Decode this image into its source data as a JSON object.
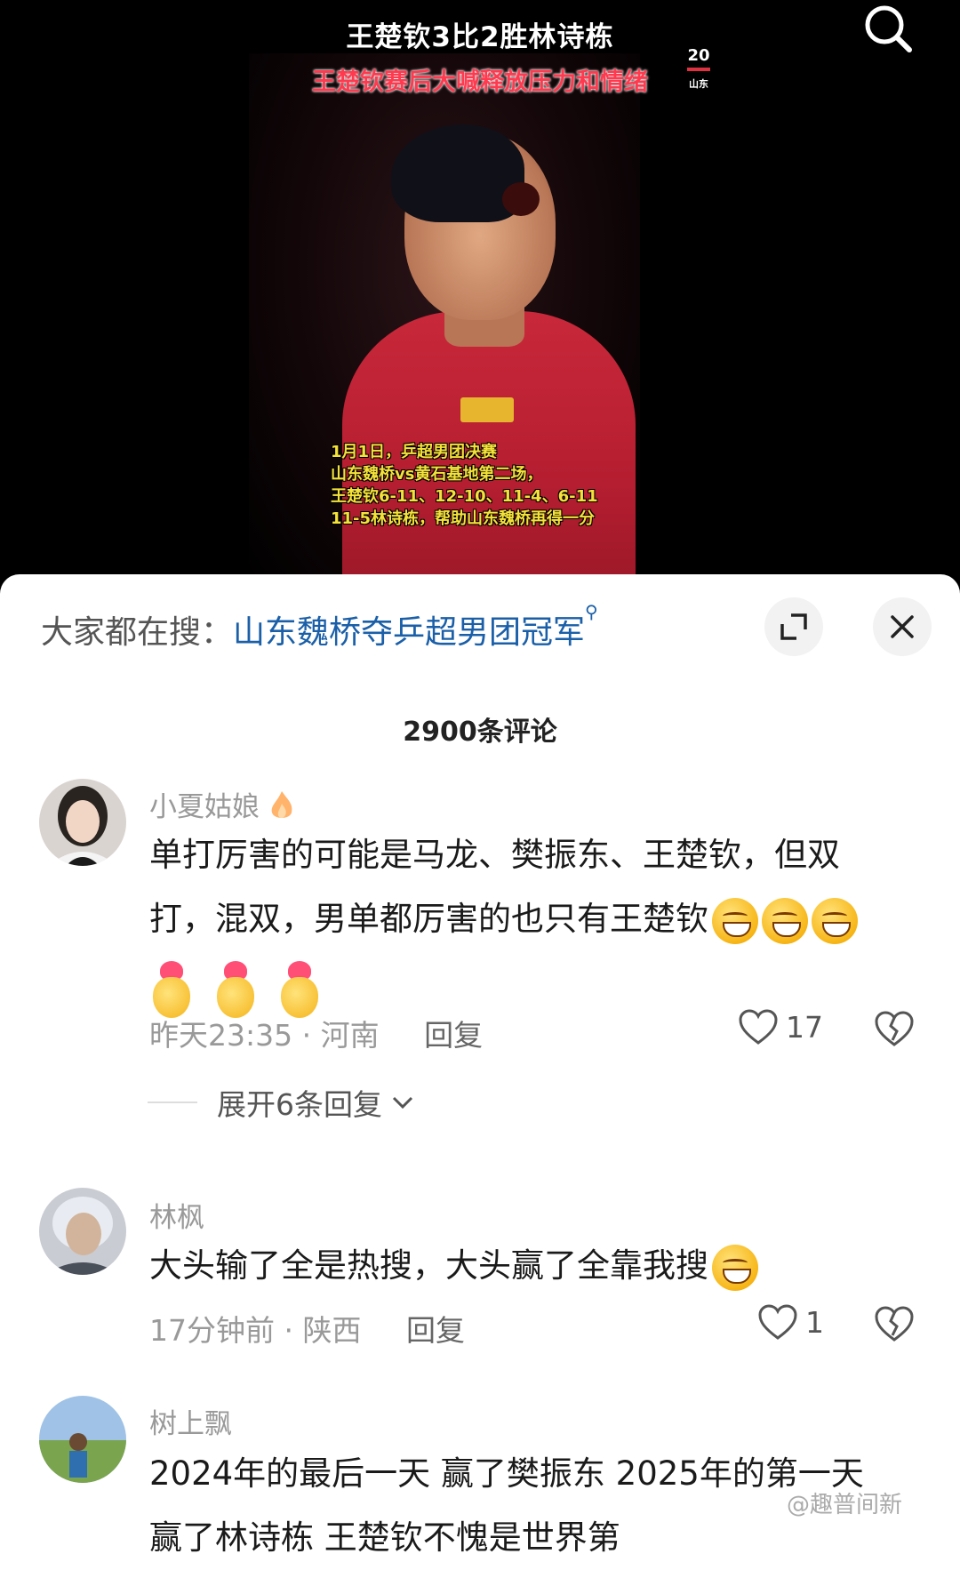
{
  "video": {
    "title": "王楚钦3比2胜林诗栋",
    "subtitle": "王楚钦赛后大喊释放压力和情绪",
    "channel_badge_top": "20",
    "channel_badge_bottom": "山东",
    "caption_lines": [
      "1月1日，乒超男团决赛",
      "山东魏桥vs黄石基地第二场，",
      "王楚钦6-11、12-10、11-4、6-11",
      "11-5林诗栋，帮助山东魏桥再得一分"
    ]
  },
  "sheet": {
    "trend_label": "大家都在搜：",
    "trend_link": "山东魏桥夺乒超男团冠军",
    "comment_count": "2900条评论"
  },
  "comments": [
    {
      "user": "小夏姑娘",
      "text_line1": "单打厉害的可能是马龙、樊振东、王楚钦，但双",
      "text_line2": "打，混双，男单都厉害的也只有王楚钦",
      "time": "昨天23:35",
      "location": "河南",
      "reply": "回复",
      "likes": "17",
      "expand": "展开6条回复"
    },
    {
      "user": "林枫",
      "text_line1": "大头输了全是热搜，大头赢了全靠我搜",
      "time": "17分钟前",
      "location": "陕西",
      "reply": "回复",
      "likes": "1"
    },
    {
      "user": "树上飘",
      "text_line1": "2024年的最后一天 赢了樊振东 2025年的第一天",
      "text_line2": "赢了林诗栋 王楚钦不愧是世界第"
    }
  ],
  "watermark": "@趣普间新",
  "colors": {
    "link": "#1a5fa8",
    "subtitle": "#ff3a4f",
    "caption": "#f4e23a",
    "jersey": "#c8283a"
  },
  "icons": [
    "search-icon",
    "expand-icon",
    "close-icon",
    "search-hint-icon",
    "heart-icon",
    "broken-heart-icon",
    "chevron-down-icon",
    "fire-icon"
  ]
}
